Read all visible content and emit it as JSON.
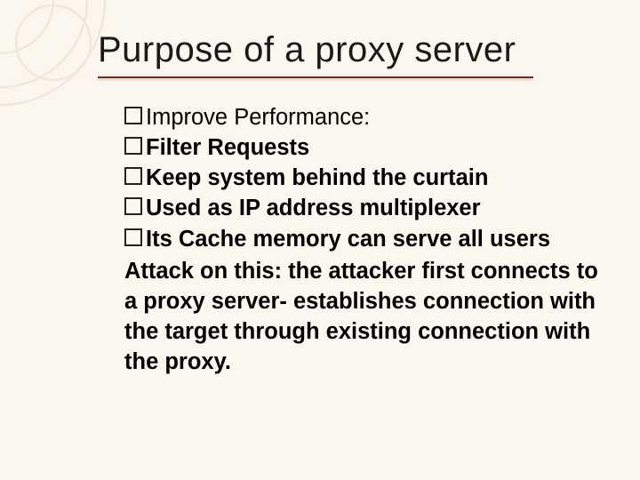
{
  "slide": {
    "title": "Purpose of a proxy server",
    "bullets": [
      {
        "lead": "Improve",
        "rest": " Performance:",
        "boldAll": false
      },
      {
        "lead": "Filter",
        "rest": " Requests",
        "boldAll": true
      },
      {
        "lead": "Keep",
        "rest": " system behind the curtain",
        "boldAll": true
      },
      {
        "lead": "Used",
        "rest": " as IP address multiplexer",
        "boldAll": true
      },
      {
        "lead": "Its",
        "rest": " Cache memory can serve all users",
        "boldAll": true
      }
    ],
    "attack": "Attack on this: the attacker first connects to a proxy server- establishes connection with the target through existing connection with the proxy."
  },
  "colors": {
    "background": "#fbf7ee",
    "titleUnderline": "#7a2b1f",
    "decoRing": "#efe8d6"
  }
}
